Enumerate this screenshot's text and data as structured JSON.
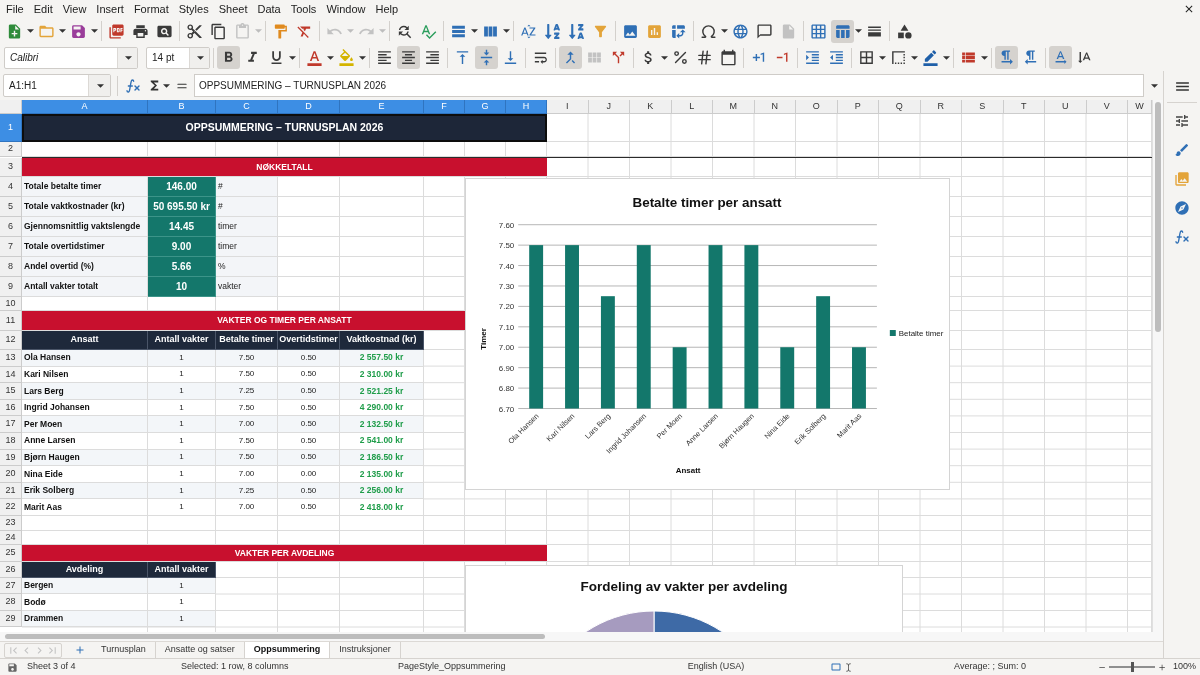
{
  "menu_bar": [
    "File",
    "Edit",
    "View",
    "Insert",
    "Format",
    "Styles",
    "Sheet",
    "Data",
    "Tools",
    "Window",
    "Help"
  ],
  "standard_toolbar": {
    "paste": {
      "disabled": true
    },
    "undo": {
      "disabled": true
    },
    "redo": {
      "disabled": true
    },
    "headers_footers": {
      "disabled": true
    },
    "freeze_rows_and_columns": {
      "on": true
    }
  },
  "formatting_toolbar": {
    "font_name": "Calibri",
    "font_size": "14 pt",
    "bold": {
      "on": true
    },
    "italic": {
      "on": false
    },
    "underline": {
      "on": false
    },
    "align_left": {
      "on": false
    },
    "align_center": {
      "on": true
    },
    "align_right": {
      "on": false
    },
    "align_top": {
      "on": false
    },
    "align_middle": {
      "on": true
    },
    "align_bottom": {
      "on": false
    },
    "merge_and_center": {
      "on": true
    },
    "merge": {
      "disabled": true
    },
    "left_to_right": {
      "on": true
    },
    "right_to_left": {
      "on": false
    },
    "text_horizontal": {
      "on": true
    },
    "text_vertical": {
      "on": false
    }
  },
  "formula_bar": {
    "name_box": "A1:H1",
    "formula": "OPPSUMMERING – TURNUSPLAN 2026"
  },
  "sheet": {
    "columns": [
      {
        "label": "A",
        "selected": true
      },
      {
        "label": "B",
        "selected": true
      },
      {
        "label": "C",
        "selected": true
      },
      {
        "label": "D",
        "selected": true
      },
      {
        "label": "E",
        "selected": true
      },
      {
        "label": "F",
        "selected": true
      },
      {
        "label": "G",
        "selected": true
      },
      {
        "label": "H",
        "selected": true
      },
      {
        "label": "I",
        "selected": false
      },
      {
        "label": "J",
        "selected": false
      },
      {
        "label": "K",
        "selected": false
      },
      {
        "label": "L",
        "selected": false
      },
      {
        "label": "M",
        "selected": false
      },
      {
        "label": "N",
        "selected": false
      },
      {
        "label": "O",
        "selected": false
      },
      {
        "label": "P",
        "selected": false
      },
      {
        "label": "Q",
        "selected": false
      },
      {
        "label": "R",
        "selected": false
      },
      {
        "label": "S",
        "selected": false
      },
      {
        "label": "T",
        "selected": false
      },
      {
        "label": "U",
        "selected": false
      },
      {
        "label": "V",
        "selected": false
      },
      {
        "label": "W",
        "selected": false
      }
    ],
    "rows": [
      {
        "label": "1",
        "selected": true
      },
      {
        "label": "2",
        "selected": false
      },
      {
        "label": "3",
        "selected": false
      },
      {
        "label": "4",
        "selected": false
      },
      {
        "label": "5",
        "selected": false
      },
      {
        "label": "6",
        "selected": false
      },
      {
        "label": "7",
        "selected": false
      },
      {
        "label": "8",
        "selected": false
      },
      {
        "label": "9",
        "selected": false
      },
      {
        "label": "10",
        "selected": false
      },
      {
        "label": "11",
        "selected": false
      },
      {
        "label": "12",
        "selected": false
      },
      {
        "label": "13",
        "selected": false
      },
      {
        "label": "14",
        "selected": false
      },
      {
        "label": "15",
        "selected": false
      },
      {
        "label": "16",
        "selected": false
      },
      {
        "label": "17",
        "selected": false
      },
      {
        "label": "18",
        "selected": false
      },
      {
        "label": "19",
        "selected": false
      },
      {
        "label": "20",
        "selected": false
      },
      {
        "label": "21",
        "selected": false
      },
      {
        "label": "22",
        "selected": false
      },
      {
        "label": "23",
        "selected": false
      },
      {
        "label": "24",
        "selected": false
      },
      {
        "label": "25",
        "selected": false
      },
      {
        "label": "26",
        "selected": false
      },
      {
        "label": "27",
        "selected": false
      },
      {
        "label": "28",
        "selected": false
      },
      {
        "label": "29",
        "selected": false
      }
    ],
    "title": "OPPSUMMERING – TURNUSPLAN 2026",
    "key_figures": {
      "heading": "NØKKELTALL",
      "rows": [
        {
          "label": "Totale betalte timer",
          "value": "146.00",
          "unit": "#"
        },
        {
          "label": "Totale vaktkostnader (kr)",
          "value": "50 695.50 kr",
          "unit": "#"
        },
        {
          "label": "Gjennomsnittlig vaktslengde",
          "value": "14.45",
          "unit": "timer"
        },
        {
          "label": "Totale overtidstimer",
          "value": "9.00",
          "unit": "timer"
        },
        {
          "label": "Andel overtid (%)",
          "value": "5.66",
          "unit": "%"
        },
        {
          "label": "Antall vakter totalt",
          "value": "10",
          "unit": "vakter"
        }
      ]
    },
    "per_employee": {
      "heading": "VAKTER OG TIMER PER ANSATT",
      "columns": [
        "Ansatt",
        "Antall vakter",
        "Betalte timer",
        "Overtidstimer",
        "Vaktkostnad (kr)"
      ],
      "rows": [
        [
          "Ola Hansen",
          "1",
          "7.50",
          "0.50",
          "2 557.50 kr"
        ],
        [
          "Kari Nilsen",
          "1",
          "7.50",
          "0.50",
          "2 310.00 kr"
        ],
        [
          "Lars Berg",
          "1",
          "7.25",
          "0.50",
          "2 521.25 kr"
        ],
        [
          "Ingrid Johansen",
          "1",
          "7.50",
          "0.50",
          "4 290.00 kr"
        ],
        [
          "Per Moen",
          "1",
          "7.00",
          "0.50",
          "2 132.50 kr"
        ],
        [
          "Anne Larsen",
          "1",
          "7.50",
          "0.50",
          "2 541.00 kr"
        ],
        [
          "Bjørn Haugen",
          "1",
          "7.50",
          "0.50",
          "2 186.50 kr"
        ],
        [
          "Nina Eide",
          "1",
          "7.00",
          "0.00",
          "2 135.00 kr"
        ],
        [
          "Erik Solberg",
          "1",
          "7.25",
          "0.50",
          "2 256.00 kr"
        ],
        [
          "Marit Aas",
          "1",
          "7.00",
          "0.50",
          "2 418.00 kr"
        ]
      ]
    },
    "per_department": {
      "heading": "VAKTER PER AVDELING",
      "columns": [
        "Avdeling",
        "Antall vakter"
      ],
      "rows": [
        [
          "Bergen",
          "1"
        ],
        [
          "Bodø",
          "1"
        ],
        [
          "Drammen",
          "1"
        ]
      ]
    }
  },
  "paid_hours_chart": {
    "chart_data": {
      "type": "bar",
      "title": "Betalte timer per ansatt",
      "xlabel": "Ansatt",
      "ylabel": "Timer",
      "categories": [
        "Ola Hansen",
        "Kari Nilsen",
        "Lars Berg",
        "Ingrid Johansen",
        "Per Moen",
        "Anne Larsen",
        "Bjørn Haugen",
        "Nina Eide",
        "Erik Solberg",
        "Marit Aas"
      ],
      "series": [
        {
          "name": "Betalte timer",
          "color": "#13776b",
          "values": [
            7.5,
            7.5,
            7.25,
            7.5,
            7,
            7.5,
            7.5,
            7,
            7.25,
            7
          ]
        }
      ],
      "ylim": [
        6.7,
        7.6
      ],
      "yticks": [
        {
          "value": 6.7,
          "label": "6.70"
        },
        {
          "value": 6.8,
          "label": "6.80"
        },
        {
          "value": 6.9,
          "label": "6.90"
        },
        {
          "value": 7.0,
          "label": "7.00"
        },
        {
          "value": 7.1,
          "label": "7.10"
        },
        {
          "value": 7.2,
          "label": "7.20"
        },
        {
          "value": 7.3,
          "label": "7.30"
        },
        {
          "value": 7.4,
          "label": "7.40"
        },
        {
          "value": 7.5,
          "label": "7.50"
        },
        {
          "value": 7.6,
          "label": "7.60"
        }
      ],
      "grid": true
    }
  },
  "department_chart": {
    "title": "Fordeling av vakter per avdeling"
  },
  "sheet_navigation": {
    "disabled": true
  },
  "sheet_tabs": [
    {
      "label": "Turnusplan",
      "selected": false
    },
    {
      "label": "Ansatte og satser",
      "selected": false
    },
    {
      "label": "Oppsummering",
      "selected": true
    },
    {
      "label": "Instruksjoner",
      "selected": false
    }
  ],
  "status_bar": {
    "sheet": "Sheet 3 of 4",
    "selection": "Selected: 1 row, 8 columns",
    "page_style": "PageStyle_Oppsummering",
    "language": "English (USA)",
    "summary": "Average: ; Sum: 0",
    "zoom": {
      "level": 0.5,
      "reading": "100%"
    }
  }
}
